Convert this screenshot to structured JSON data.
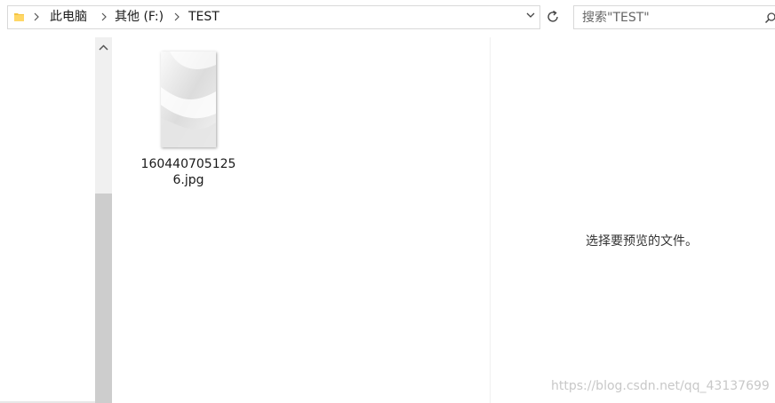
{
  "address": {
    "breadcrumbs": [
      "此电脑",
      "其他 (F:)",
      "TEST"
    ]
  },
  "search": {
    "placeholder": "搜索\"TEST\""
  },
  "files": [
    {
      "name": "1604407051256.jpg",
      "name_line1": "160440705125",
      "name_line2": "6.jpg"
    }
  ],
  "preview": {
    "message": "选择要预览的文件。"
  },
  "watermark": "https://blog.csdn.net/qq_43137699",
  "colors": {
    "folder": "#f5c542",
    "scroll_thumb": "#cdcdcd",
    "border": "#d9d9d9"
  },
  "icons": [
    "folder-icon",
    "chevron-right-icon",
    "chevron-down-icon",
    "refresh-icon",
    "search-icon",
    "chevron-up-icon"
  ]
}
